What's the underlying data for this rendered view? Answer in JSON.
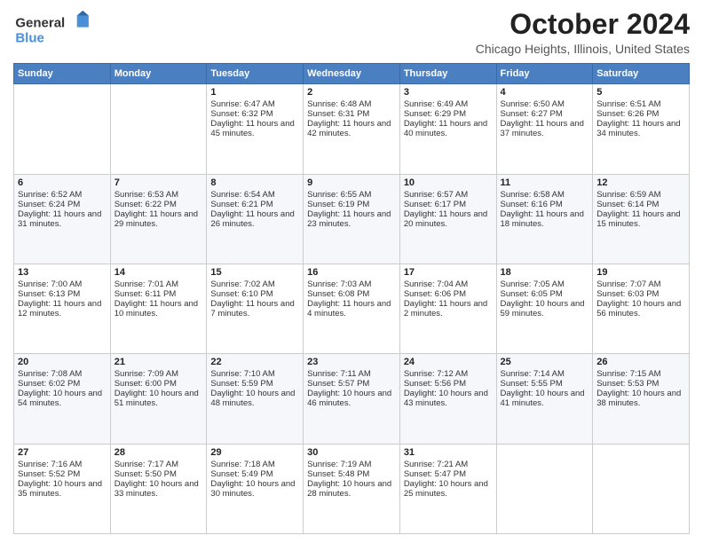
{
  "header": {
    "logo_general": "General",
    "logo_blue": "Blue",
    "month_title": "October 2024",
    "location": "Chicago Heights, Illinois, United States"
  },
  "days_of_week": [
    "Sunday",
    "Monday",
    "Tuesday",
    "Wednesday",
    "Thursday",
    "Friday",
    "Saturday"
  ],
  "weeks": [
    [
      {
        "day": null,
        "sunrise": null,
        "sunset": null,
        "daylight": null
      },
      {
        "day": null,
        "sunrise": null,
        "sunset": null,
        "daylight": null
      },
      {
        "day": "1",
        "sunrise": "Sunrise: 6:47 AM",
        "sunset": "Sunset: 6:32 PM",
        "daylight": "Daylight: 11 hours and 45 minutes."
      },
      {
        "day": "2",
        "sunrise": "Sunrise: 6:48 AM",
        "sunset": "Sunset: 6:31 PM",
        "daylight": "Daylight: 11 hours and 42 minutes."
      },
      {
        "day": "3",
        "sunrise": "Sunrise: 6:49 AM",
        "sunset": "Sunset: 6:29 PM",
        "daylight": "Daylight: 11 hours and 40 minutes."
      },
      {
        "day": "4",
        "sunrise": "Sunrise: 6:50 AM",
        "sunset": "Sunset: 6:27 PM",
        "daylight": "Daylight: 11 hours and 37 minutes."
      },
      {
        "day": "5",
        "sunrise": "Sunrise: 6:51 AM",
        "sunset": "Sunset: 6:26 PM",
        "daylight": "Daylight: 11 hours and 34 minutes."
      }
    ],
    [
      {
        "day": "6",
        "sunrise": "Sunrise: 6:52 AM",
        "sunset": "Sunset: 6:24 PM",
        "daylight": "Daylight: 11 hours and 31 minutes."
      },
      {
        "day": "7",
        "sunrise": "Sunrise: 6:53 AM",
        "sunset": "Sunset: 6:22 PM",
        "daylight": "Daylight: 11 hours and 29 minutes."
      },
      {
        "day": "8",
        "sunrise": "Sunrise: 6:54 AM",
        "sunset": "Sunset: 6:21 PM",
        "daylight": "Daylight: 11 hours and 26 minutes."
      },
      {
        "day": "9",
        "sunrise": "Sunrise: 6:55 AM",
        "sunset": "Sunset: 6:19 PM",
        "daylight": "Daylight: 11 hours and 23 minutes."
      },
      {
        "day": "10",
        "sunrise": "Sunrise: 6:57 AM",
        "sunset": "Sunset: 6:17 PM",
        "daylight": "Daylight: 11 hours and 20 minutes."
      },
      {
        "day": "11",
        "sunrise": "Sunrise: 6:58 AM",
        "sunset": "Sunset: 6:16 PM",
        "daylight": "Daylight: 11 hours and 18 minutes."
      },
      {
        "day": "12",
        "sunrise": "Sunrise: 6:59 AM",
        "sunset": "Sunset: 6:14 PM",
        "daylight": "Daylight: 11 hours and 15 minutes."
      }
    ],
    [
      {
        "day": "13",
        "sunrise": "Sunrise: 7:00 AM",
        "sunset": "Sunset: 6:13 PM",
        "daylight": "Daylight: 11 hours and 12 minutes."
      },
      {
        "day": "14",
        "sunrise": "Sunrise: 7:01 AM",
        "sunset": "Sunset: 6:11 PM",
        "daylight": "Daylight: 11 hours and 10 minutes."
      },
      {
        "day": "15",
        "sunrise": "Sunrise: 7:02 AM",
        "sunset": "Sunset: 6:10 PM",
        "daylight": "Daylight: 11 hours and 7 minutes."
      },
      {
        "day": "16",
        "sunrise": "Sunrise: 7:03 AM",
        "sunset": "Sunset: 6:08 PM",
        "daylight": "Daylight: 11 hours and 4 minutes."
      },
      {
        "day": "17",
        "sunrise": "Sunrise: 7:04 AM",
        "sunset": "Sunset: 6:06 PM",
        "daylight": "Daylight: 11 hours and 2 minutes."
      },
      {
        "day": "18",
        "sunrise": "Sunrise: 7:05 AM",
        "sunset": "Sunset: 6:05 PM",
        "daylight": "Daylight: 10 hours and 59 minutes."
      },
      {
        "day": "19",
        "sunrise": "Sunrise: 7:07 AM",
        "sunset": "Sunset: 6:03 PM",
        "daylight": "Daylight: 10 hours and 56 minutes."
      }
    ],
    [
      {
        "day": "20",
        "sunrise": "Sunrise: 7:08 AM",
        "sunset": "Sunset: 6:02 PM",
        "daylight": "Daylight: 10 hours and 54 minutes."
      },
      {
        "day": "21",
        "sunrise": "Sunrise: 7:09 AM",
        "sunset": "Sunset: 6:00 PM",
        "daylight": "Daylight: 10 hours and 51 minutes."
      },
      {
        "day": "22",
        "sunrise": "Sunrise: 7:10 AM",
        "sunset": "Sunset: 5:59 PM",
        "daylight": "Daylight: 10 hours and 48 minutes."
      },
      {
        "day": "23",
        "sunrise": "Sunrise: 7:11 AM",
        "sunset": "Sunset: 5:57 PM",
        "daylight": "Daylight: 10 hours and 46 minutes."
      },
      {
        "day": "24",
        "sunrise": "Sunrise: 7:12 AM",
        "sunset": "Sunset: 5:56 PM",
        "daylight": "Daylight: 10 hours and 43 minutes."
      },
      {
        "day": "25",
        "sunrise": "Sunrise: 7:14 AM",
        "sunset": "Sunset: 5:55 PM",
        "daylight": "Daylight: 10 hours and 41 minutes."
      },
      {
        "day": "26",
        "sunrise": "Sunrise: 7:15 AM",
        "sunset": "Sunset: 5:53 PM",
        "daylight": "Daylight: 10 hours and 38 minutes."
      }
    ],
    [
      {
        "day": "27",
        "sunrise": "Sunrise: 7:16 AM",
        "sunset": "Sunset: 5:52 PM",
        "daylight": "Daylight: 10 hours and 35 minutes."
      },
      {
        "day": "28",
        "sunrise": "Sunrise: 7:17 AM",
        "sunset": "Sunset: 5:50 PM",
        "daylight": "Daylight: 10 hours and 33 minutes."
      },
      {
        "day": "29",
        "sunrise": "Sunrise: 7:18 AM",
        "sunset": "Sunset: 5:49 PM",
        "daylight": "Daylight: 10 hours and 30 minutes."
      },
      {
        "day": "30",
        "sunrise": "Sunrise: 7:19 AM",
        "sunset": "Sunset: 5:48 PM",
        "daylight": "Daylight: 10 hours and 28 minutes."
      },
      {
        "day": "31",
        "sunrise": "Sunrise: 7:21 AM",
        "sunset": "Sunset: 5:47 PM",
        "daylight": "Daylight: 10 hours and 25 minutes."
      },
      {
        "day": null,
        "sunrise": null,
        "sunset": null,
        "daylight": null
      },
      {
        "day": null,
        "sunrise": null,
        "sunset": null,
        "daylight": null
      }
    ]
  ]
}
